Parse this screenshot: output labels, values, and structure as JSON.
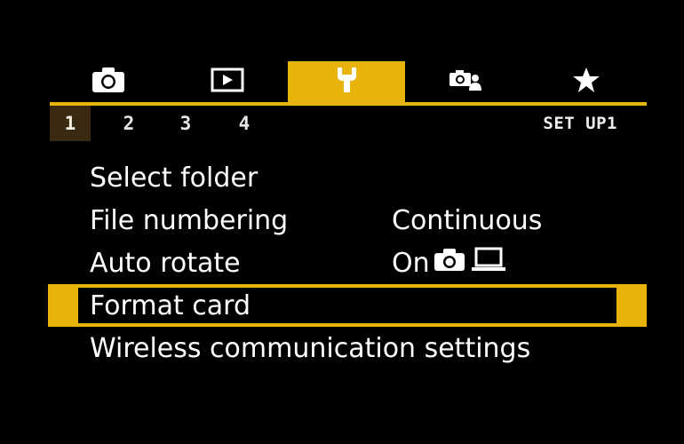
{
  "tabs": [
    {
      "icon": "camera-icon",
      "active": false
    },
    {
      "icon": "playback-icon",
      "active": false
    },
    {
      "icon": "wrench-icon",
      "active": true
    },
    {
      "icon": "camera-person-icon",
      "active": false
    },
    {
      "icon": "star-icon",
      "active": false
    }
  ],
  "pages": [
    "1",
    "2",
    "3",
    "4"
  ],
  "active_page": "1",
  "section_label": "SET UP1",
  "menu": {
    "items": [
      {
        "label": "Select folder",
        "value": ""
      },
      {
        "label": "File numbering",
        "value": "Continuous"
      },
      {
        "label": "Auto rotate",
        "value": "On"
      },
      {
        "label": "Format card",
        "value": ""
      },
      {
        "label": "Wireless communication settings",
        "value": ""
      }
    ],
    "selected_index": 3
  },
  "colors": {
    "accent": "#e8b30a",
    "background": "#000000",
    "active_page_bg": "#3b2a12"
  }
}
